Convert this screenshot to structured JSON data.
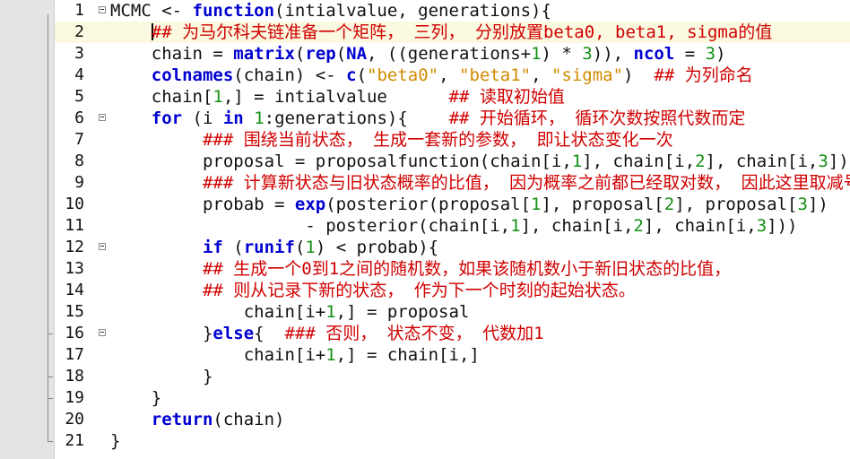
{
  "lines": [
    {
      "n": "1",
      "t": [
        {
          "c": "",
          "v": "MCMC <- "
        },
        {
          "c": "kw",
          "v": "function"
        },
        {
          "c": "",
          "v": "(intialvalue, generations){"
        }
      ]
    },
    {
      "n": "2",
      "t": [
        {
          "c": "",
          "v": "    "
        },
        {
          "c": "cm",
          "v": "## 为马尔科夫链准备一个矩阵， 三列， 分别放置beta0, beta1, sigma的值"
        }
      ]
    },
    {
      "n": "3",
      "t": [
        {
          "c": "",
          "v": "    chain = "
        },
        {
          "c": "kw",
          "v": "matrix"
        },
        {
          "c": "",
          "v": "("
        },
        {
          "c": "kw",
          "v": "rep"
        },
        {
          "c": "",
          "v": "("
        },
        {
          "c": "kw",
          "v": "NA"
        },
        {
          "c": "",
          "v": ", ((generations+"
        },
        {
          "c": "num",
          "v": "1"
        },
        {
          "c": "",
          "v": ") * "
        },
        {
          "c": "num",
          "v": "3"
        },
        {
          "c": "",
          "v": ")), "
        },
        {
          "c": "kw",
          "v": "ncol"
        },
        {
          "c": "",
          "v": " = "
        },
        {
          "c": "num",
          "v": "3"
        },
        {
          "c": "",
          "v": ")"
        }
      ]
    },
    {
      "n": "4",
      "t": [
        {
          "c": "",
          "v": "    "
        },
        {
          "c": "kw",
          "v": "colnames"
        },
        {
          "c": "",
          "v": "(chain) <- "
        },
        {
          "c": "kw",
          "v": "c"
        },
        {
          "c": "",
          "v": "("
        },
        {
          "c": "str",
          "v": "\"beta0\""
        },
        {
          "c": "",
          "v": ", "
        },
        {
          "c": "str",
          "v": "\"beta1\""
        },
        {
          "c": "",
          "v": ", "
        },
        {
          "c": "str",
          "v": "\"sigma\""
        },
        {
          "c": "",
          "v": ")  "
        },
        {
          "c": "cm",
          "v": "## 为列命名"
        }
      ]
    },
    {
      "n": "5",
      "t": [
        {
          "c": "",
          "v": "    chain["
        },
        {
          "c": "num",
          "v": "1"
        },
        {
          "c": "",
          "v": ",] = intialvalue      "
        },
        {
          "c": "cm",
          "v": "## 读取初始值"
        }
      ]
    },
    {
      "n": "6",
      "t": [
        {
          "c": "",
          "v": "    "
        },
        {
          "c": "kw",
          "v": "for"
        },
        {
          "c": "",
          "v": " (i "
        },
        {
          "c": "kw",
          "v": "in"
        },
        {
          "c": "",
          "v": " "
        },
        {
          "c": "num",
          "v": "1"
        },
        {
          "c": "",
          "v": ":generations){    "
        },
        {
          "c": "cm",
          "v": "## 开始循环， 循环次数按照代数而定"
        }
      ]
    },
    {
      "n": "7",
      "t": [
        {
          "c": "",
          "v": "         "
        },
        {
          "c": "cm",
          "v": "### 围绕当前状态， 生成一套新的参数， 即让状态变化一次"
        }
      ]
    },
    {
      "n": "8",
      "t": [
        {
          "c": "",
          "v": "         proposal = proposalfunction(chain[i,"
        },
        {
          "c": "num",
          "v": "1"
        },
        {
          "c": "",
          "v": "], chain[i,"
        },
        {
          "c": "num",
          "v": "2"
        },
        {
          "c": "",
          "v": "], chain[i,"
        },
        {
          "c": "num",
          "v": "3"
        },
        {
          "c": "",
          "v": "])"
        }
      ]
    },
    {
      "n": "9",
      "t": [
        {
          "c": "",
          "v": "         "
        },
        {
          "c": "cm",
          "v": "### 计算新状态与旧状态概率的比值， 因为概率之前都已经取对数， 因此这里取减号。"
        }
      ]
    },
    {
      "n": "10",
      "t": [
        {
          "c": "",
          "v": "         probab = "
        },
        {
          "c": "kw",
          "v": "exp"
        },
        {
          "c": "",
          "v": "(posterior(proposal["
        },
        {
          "c": "num",
          "v": "1"
        },
        {
          "c": "",
          "v": "], proposal["
        },
        {
          "c": "num",
          "v": "2"
        },
        {
          "c": "",
          "v": "], proposal["
        },
        {
          "c": "num",
          "v": "3"
        },
        {
          "c": "",
          "v": "])"
        }
      ]
    },
    {
      "n": "11",
      "t": [
        {
          "c": "",
          "v": "                   - posterior(chain[i,"
        },
        {
          "c": "num",
          "v": "1"
        },
        {
          "c": "",
          "v": "], chain[i,"
        },
        {
          "c": "num",
          "v": "2"
        },
        {
          "c": "",
          "v": "], chain[i,"
        },
        {
          "c": "num",
          "v": "3"
        },
        {
          "c": "",
          "v": "]))"
        }
      ]
    },
    {
      "n": "12",
      "t": [
        {
          "c": "",
          "v": "         "
        },
        {
          "c": "kw",
          "v": "if"
        },
        {
          "c": "",
          "v": " ("
        },
        {
          "c": "kw",
          "v": "runif"
        },
        {
          "c": "",
          "v": "("
        },
        {
          "c": "num",
          "v": "1"
        },
        {
          "c": "",
          "v": ") < probab){"
        }
      ]
    },
    {
      "n": "13",
      "t": [
        {
          "c": "",
          "v": "         "
        },
        {
          "c": "cm",
          "v": "## 生成一个0到1之间的随机数，如果该随机数小于新旧状态的比值，"
        }
      ]
    },
    {
      "n": "14",
      "t": [
        {
          "c": "",
          "v": "         "
        },
        {
          "c": "cm",
          "v": "## 则从记录下新的状态， 作为下一个时刻的起始状态。"
        }
      ]
    },
    {
      "n": "15",
      "t": [
        {
          "c": "",
          "v": "             chain[i+"
        },
        {
          "c": "num",
          "v": "1"
        },
        {
          "c": "",
          "v": ",] = proposal"
        }
      ]
    },
    {
      "n": "16",
      "t": [
        {
          "c": "",
          "v": "         }"
        },
        {
          "c": "kw",
          "v": "else"
        },
        {
          "c": "",
          "v": "{  "
        },
        {
          "c": "cm",
          "v": "### 否则， 状态不变， 代数加1"
        }
      ]
    },
    {
      "n": "17",
      "t": [
        {
          "c": "",
          "v": "             chain[i+"
        },
        {
          "c": "num",
          "v": "1"
        },
        {
          "c": "",
          "v": ",] = chain[i,]"
        }
      ]
    },
    {
      "n": "18",
      "t": [
        {
          "c": "",
          "v": "         }"
        }
      ]
    },
    {
      "n": "19",
      "t": [
        {
          "c": "",
          "v": "    }"
        }
      ]
    },
    {
      "n": "20",
      "t": [
        {
          "c": "",
          "v": "    "
        },
        {
          "c": "kw",
          "v": "return"
        },
        {
          "c": "",
          "v": "(chain)"
        }
      ]
    },
    {
      "n": "21",
      "t": [
        {
          "c": "",
          "v": "}"
        }
      ]
    }
  ],
  "editor": {
    "active_line": 2,
    "fold_lines": [
      1,
      6,
      12,
      16
    ]
  },
  "colors": {
    "keyword": "#0000d0",
    "string": "#d08a00",
    "number": "#159015",
    "comment": "#d00000",
    "gutter": "#e4e4e4",
    "active_line": "#fbf9e0"
  }
}
